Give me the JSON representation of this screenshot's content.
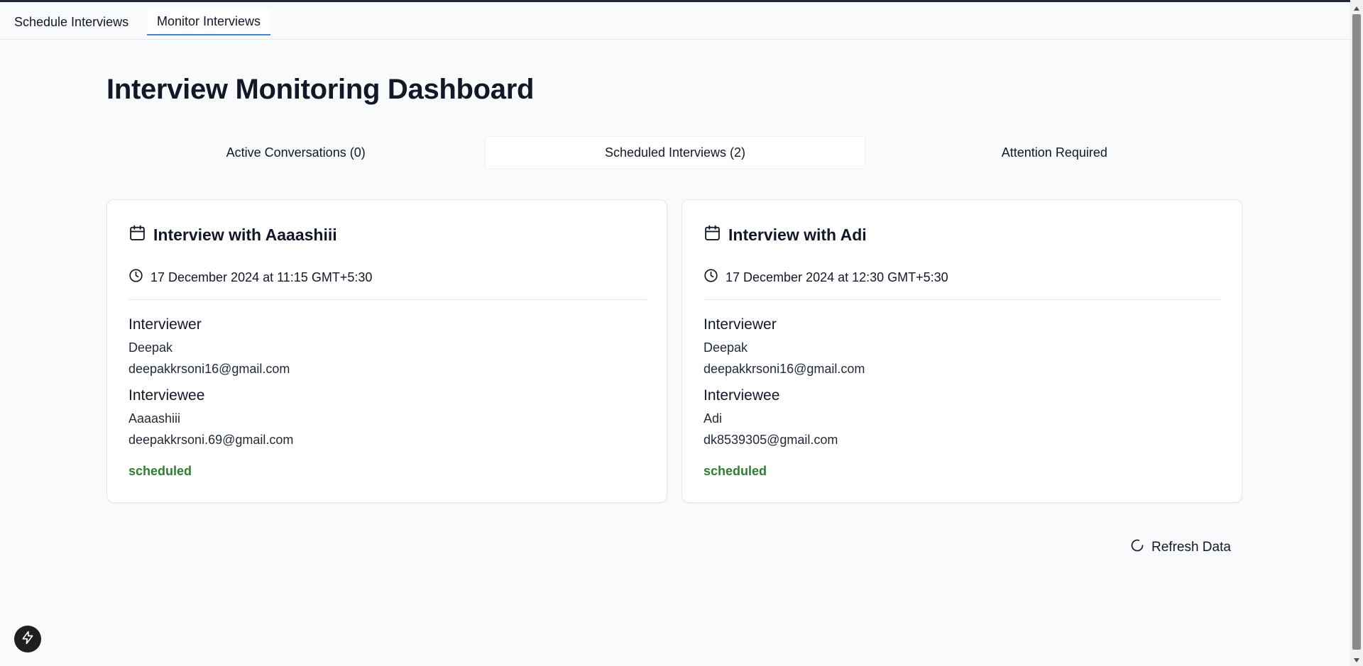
{
  "nav": {
    "tabs": [
      {
        "label": "Schedule Interviews"
      },
      {
        "label": "Monitor Interviews",
        "active": true
      }
    ]
  },
  "page": {
    "title": "Interview Monitoring Dashboard"
  },
  "tabs": [
    {
      "label": "Active Conversations (0)"
    },
    {
      "label": "Scheduled Interviews (2)",
      "active": true
    },
    {
      "label": "Attention Required"
    }
  ],
  "cards": [
    {
      "title": "Interview with Aaaashiii",
      "datetime": "17 December 2024 at 11:15 GMT+5:30",
      "interviewer_label": "Interviewer",
      "interviewer_name": "Deepak",
      "interviewer_email": "deepakkrsoni16@gmail.com",
      "interviewee_label": "Interviewee",
      "interviewee_name": "Aaaashiii",
      "interviewee_email": "deepakkrsoni.69@gmail.com",
      "status": "scheduled"
    },
    {
      "title": "Interview with Adi",
      "datetime": "17 December 2024 at 12:30 GMT+5:30",
      "interviewer_label": "Interviewer",
      "interviewer_name": "Deepak",
      "interviewer_email": "deepakkrsoni16@gmail.com",
      "interviewee_label": "Interviewee",
      "interviewee_name": "Adi",
      "interviewee_email": "dk8539305@gmail.com",
      "status": "scheduled"
    }
  ],
  "refresh": {
    "label": "Refresh Data",
    "icon": "refresh-icon"
  },
  "floating": {
    "icon": "bolt-icon"
  },
  "colors": {
    "status_scheduled": "#2e7d32",
    "active_tab_underline": "#3b82f6"
  }
}
